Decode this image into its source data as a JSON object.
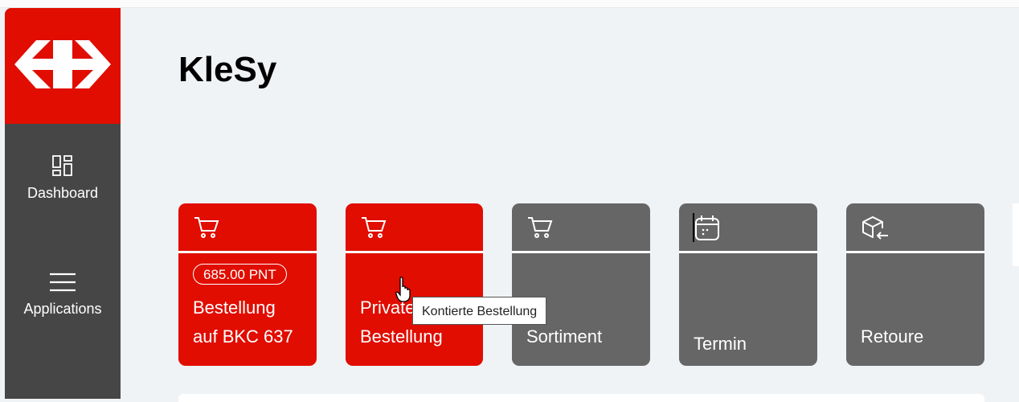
{
  "sidebar": {
    "logo": "sbb-logo",
    "items": [
      {
        "label": "Dashboard",
        "icon": "dashboard-icon"
      },
      {
        "label": "Applications",
        "icon": "menu-icon"
      }
    ]
  },
  "main": {
    "title": "KleSy",
    "tiles": [
      {
        "badge": "685.00 PNT",
        "line1": "Bestellung",
        "line2": "auf BKC 637",
        "icon": "cart-icon",
        "color": "#e00d00"
      },
      {
        "line1": "Private",
        "line2": "Bestellung",
        "icon": "cart-icon",
        "color": "#e00d00"
      },
      {
        "line1": "Sortiment",
        "icon": "cart-icon",
        "color": "#666666"
      },
      {
        "line1": "Termin",
        "icon": "calendar-icon",
        "color": "#666666"
      },
      {
        "line1": "Retoure",
        "icon": "box-return-icon",
        "color": "#666666"
      }
    ]
  },
  "tooltip": "Kontierte Bestellung",
  "colors": {
    "brand_red": "#e00d00",
    "sidebar_bg": "#464646",
    "tile_grey": "#666666",
    "page_bg": "#f0f3f6"
  }
}
